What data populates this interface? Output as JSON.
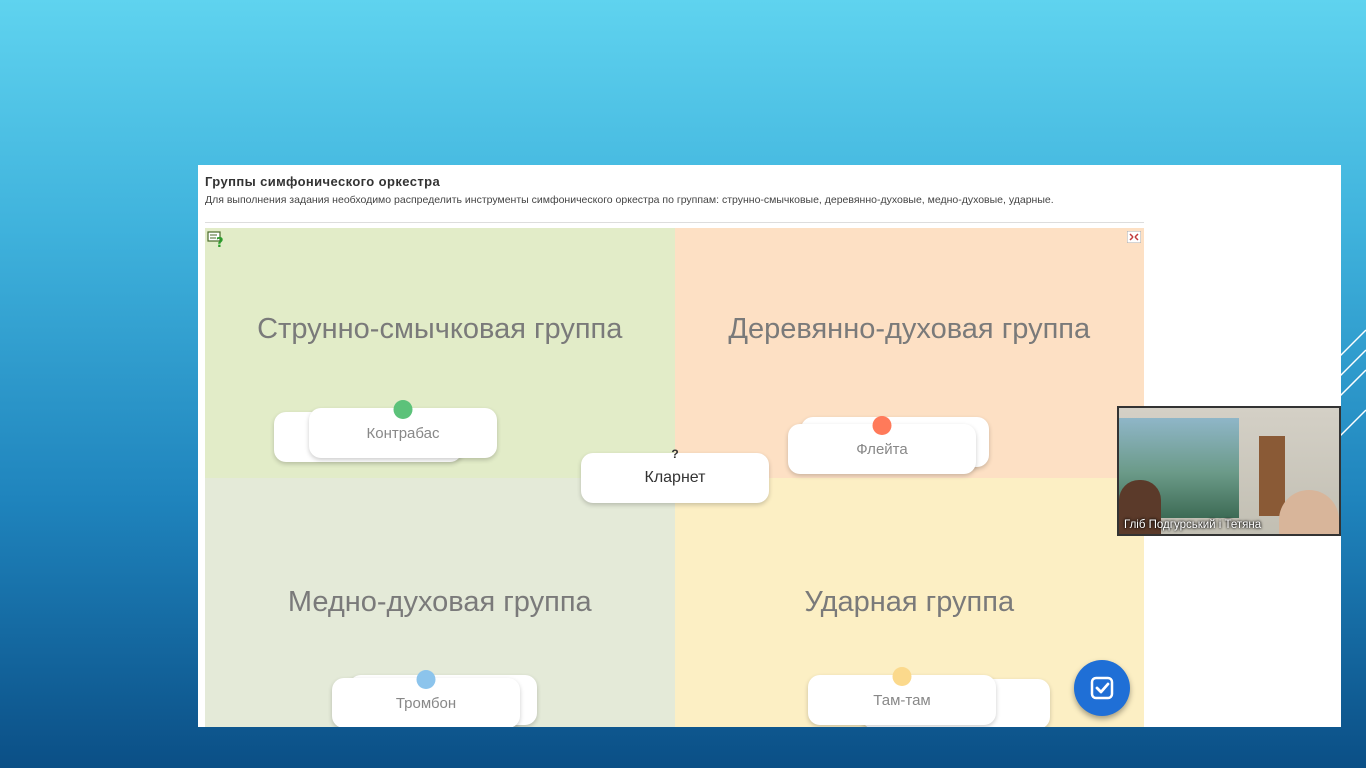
{
  "task": {
    "title": "Группы симфонического оркестра",
    "description": "Для выполнения задания необходимо распределить инструменты симфонического оркестра по группам: струнно-смычковые, деревянно-духовые, медно-духовые, ударные."
  },
  "groups": [
    {
      "title": "Струнно-смычковая группа",
      "color": "#e2ecc8"
    },
    {
      "title": "Деревянно-духовая группа",
      "color": "#fde0c4"
    },
    {
      "title": "Медно-духовая группа",
      "color": "#e4ead8"
    },
    {
      "title": "Ударная группа",
      "color": "#fcefc4"
    }
  ],
  "cards": {
    "strings_top": "Контрабас",
    "woodwind_top": "Флейта",
    "brass_top": "Тромбон",
    "percussion_top": "Там-там",
    "current": "Кларнет",
    "current_marker": "?"
  },
  "dot_colors": {
    "strings": "#5cc27a",
    "woodwind": "#ff7a5a",
    "brass": "#8cc4ec",
    "percussion": "#fbd98c"
  },
  "icons": {
    "help": "help-icon",
    "fullscreen": "fullscreen-icon",
    "check": "check-icon"
  },
  "video": {
    "participant_name": "Гліб Подгурський і Тетяна"
  }
}
